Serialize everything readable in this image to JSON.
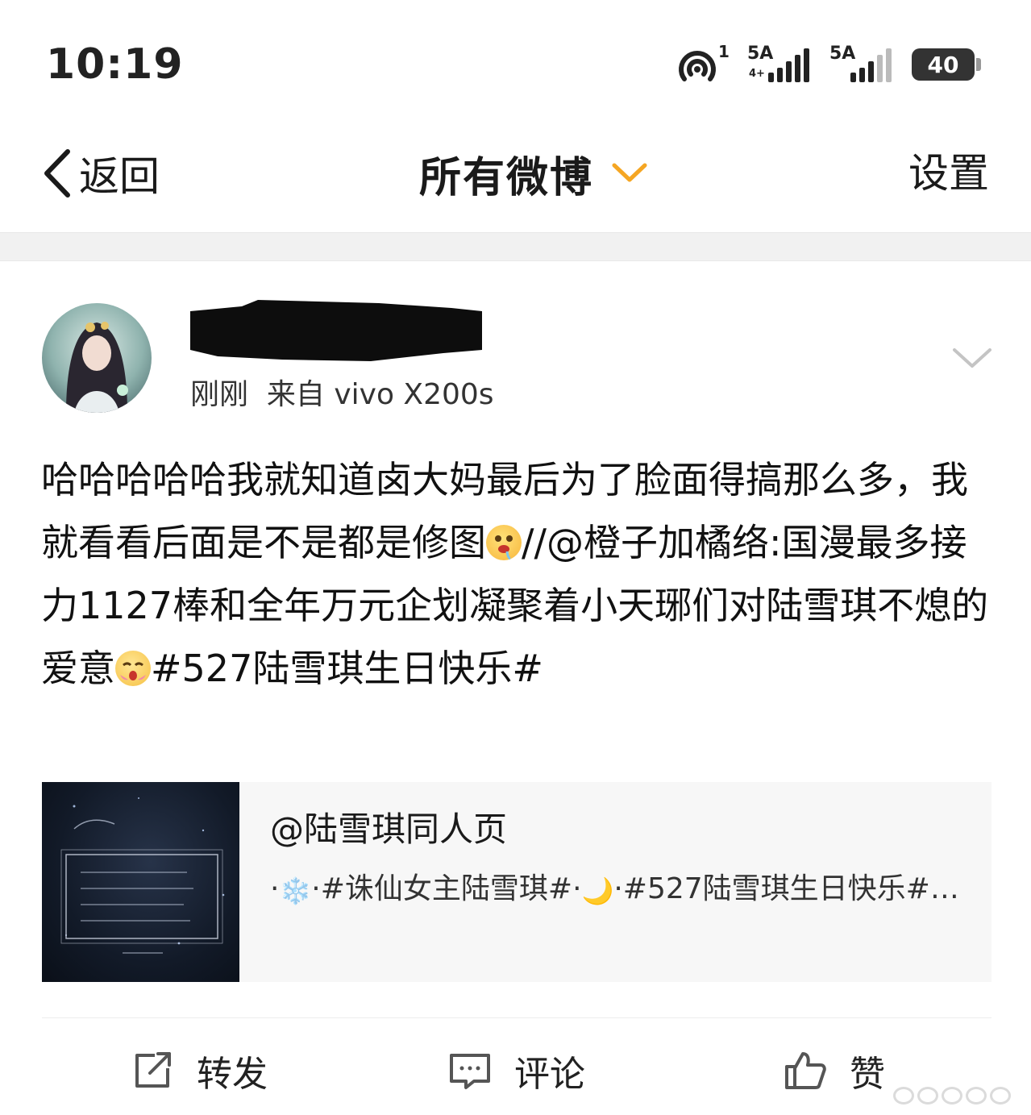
{
  "status_bar": {
    "time": "10:19",
    "hotspot_count": "1",
    "sim1_label": "5A",
    "sim1_sub": "4+",
    "sim2_label": "5A",
    "battery_level": "40"
  },
  "nav": {
    "back_label": "返回",
    "title": "所有微博",
    "settings_label": "设置"
  },
  "post": {
    "meta": "刚刚  来自 vivo X200s",
    "text_part1": "哈哈哈哈哈我就知道卤大妈最后为了脸面得搞那么多，我就看看后面是不是都是修图",
    "text_part2": "//@橙子加橘络:国漫最多接力1127棒和全年万元企划凝聚着小天琊们对陆雪琪不熄的爱意",
    "hashtag": "#527陆雪琪生日快乐#",
    "emoji_1": "drooling-face-emoji",
    "emoji_2": "crying-face-emoji"
  },
  "repost_card": {
    "title": "@陆雪琪同人页",
    "desc_part1": "·",
    "desc_snow": "❄️",
    "desc_part2": "·#诛仙女主陆雪琪#·",
    "desc_moon": "🌙",
    "desc_part3": "·#527陆雪琪生日快乐#…"
  },
  "actions": {
    "repost_label": "转发",
    "comment_label": "评论",
    "like_label": "赞"
  },
  "colors": {
    "accent_orange": "#f5a623",
    "divider": "#f1f1f1"
  }
}
